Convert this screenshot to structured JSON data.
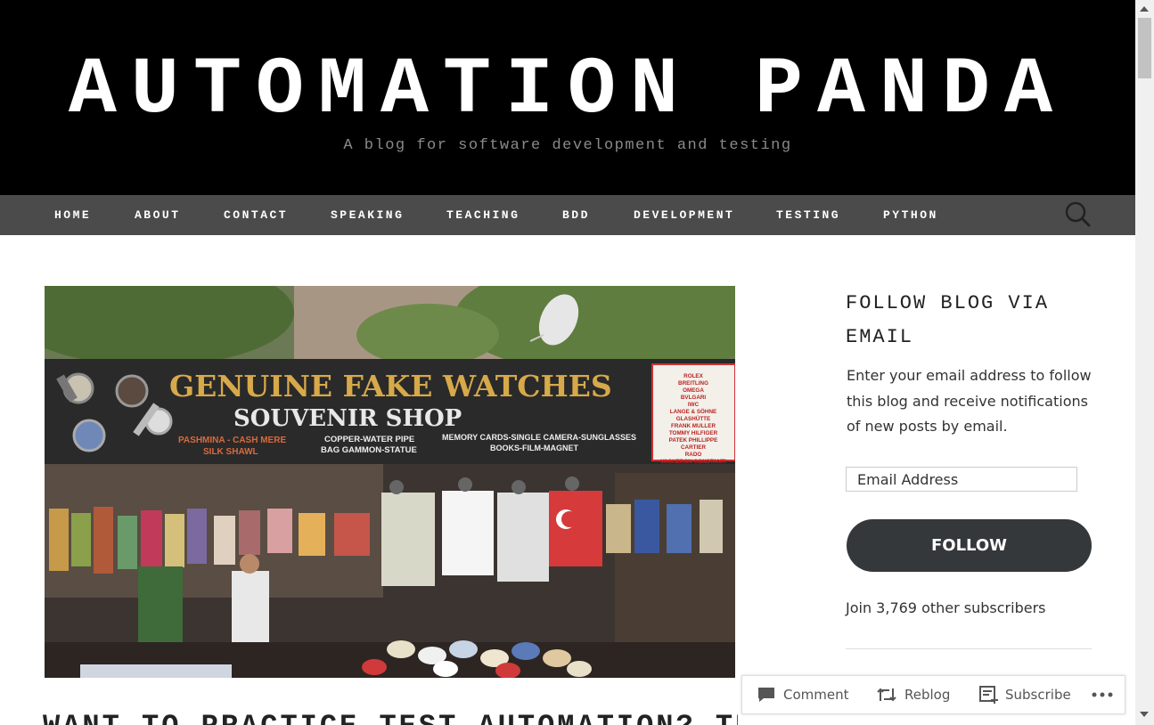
{
  "header": {
    "site_title": "AUTOMATION PANDA",
    "tagline": "A blog for software development and testing"
  },
  "nav": {
    "items": [
      "HOME",
      "ABOUT",
      "CONTACT",
      "SPEAKING",
      "TEACHING",
      "BDD",
      "DEVELOPMENT",
      "TESTING",
      "PYTHON"
    ],
    "search_icon": "search-icon"
  },
  "hero": {
    "sign_main": "GENUINE FAKE WATCHES",
    "sign_sub": "SOUVENIR SHOP",
    "sign_left_1": "PASHMINA - CASH MERE",
    "sign_left_2": "SILK SHAWL",
    "sign_mid_1": "COPPER-WATER PIPE",
    "sign_mid_2": "BAG GAMMON-STATUE",
    "sign_right_1": "MEMORY CARDS-SINGLE CAMERA-SUNGLASSES",
    "sign_right_2": "BOOKS-FILM-MAGNET",
    "brands": [
      "ROLEX",
      "BREITLING",
      "OMEGA",
      "BVLGARI",
      "IWC",
      "LANGE & SÖHNE",
      "GLASHÜTTE",
      "FRANK MULLER",
      "TOMMY HILFIGER",
      "PATEK PHILLIPPE",
      "CARTIER",
      "RADO",
      "VACHERON CONSTANTI"
    ]
  },
  "post": {
    "title": "WANT TO PRACTICE TEST AUTOMATION? TRY"
  },
  "sidebar": {
    "widget_title": "FOLLOW BLOG VIA EMAIL",
    "description": "Enter your email address to follow this blog and receive notifications of new posts by email.",
    "email_placeholder": "Email Address",
    "follow_label": "FOLLOW",
    "subscribers": "Join 3,769 other subscribers"
  },
  "action_bar": {
    "comment_label": "Comment",
    "reblog_label": "Reblog",
    "subscribe_label": "Subscribe",
    "more_icon": "more-icon"
  },
  "colors": {
    "header_bg": "#000000",
    "nav_bg": "#4b4b4b",
    "button_bg": "#35383b"
  }
}
